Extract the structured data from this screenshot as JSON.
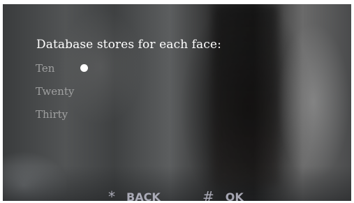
{
  "menu": {
    "title": "Database stores for each face:",
    "options": [
      {
        "label": "Ten",
        "selected": true
      },
      {
        "label": "Twenty",
        "selected": false
      },
      {
        "label": "Thirty",
        "selected": false
      }
    ]
  },
  "softkeys": {
    "back": {
      "key": "*",
      "label": "BACK"
    },
    "ok": {
      "key": "#",
      "label": "OK"
    }
  },
  "colors": {
    "title_text": "#ffffff",
    "selection_dot": "#ffffff"
  }
}
